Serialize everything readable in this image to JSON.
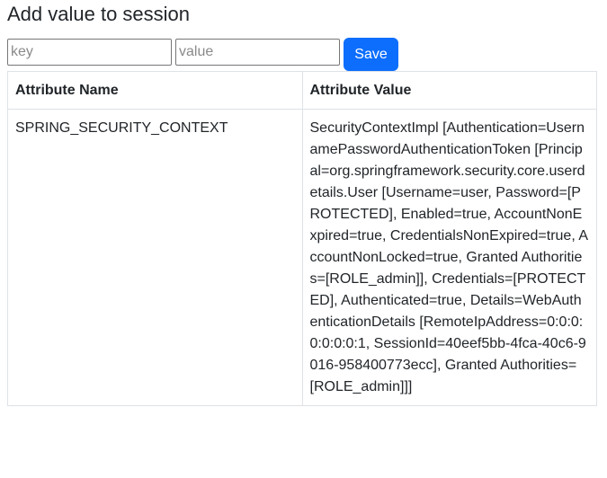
{
  "page": {
    "title": "Add value to session"
  },
  "form": {
    "key_placeholder": "key",
    "value_placeholder": "value",
    "save_label": "Save"
  },
  "table": {
    "headers": [
      "Attribute Name",
      "Attribute Value"
    ],
    "rows": [
      {
        "name": "SPRING_SECURITY_CONTEXT",
        "value": "SecurityContextImpl [Authentication=UsernamePasswordAuthenticationToken [Principal=org.springframework.security.core.userdetails.User [Username=user, Password=[PROTECTED], Enabled=true, AccountNonExpired=true, CredentialsNonExpired=true, AccountNonLocked=true, Granted Authorities=[ROLE_admin]], Credentials=[PROTECTED], Authenticated=true, Details=WebAuthenticationDetails [RemoteIpAddress=0:0:0:0:0:0:0:1, SessionId=40eef5bb-4fca-40c6-9016-958400773ecc], Granted Authorities=[ROLE_admin]]]"
      }
    ]
  },
  "colors": {
    "primary": "#0d6efd",
    "text": "#212529",
    "border": "#dee2e6"
  }
}
